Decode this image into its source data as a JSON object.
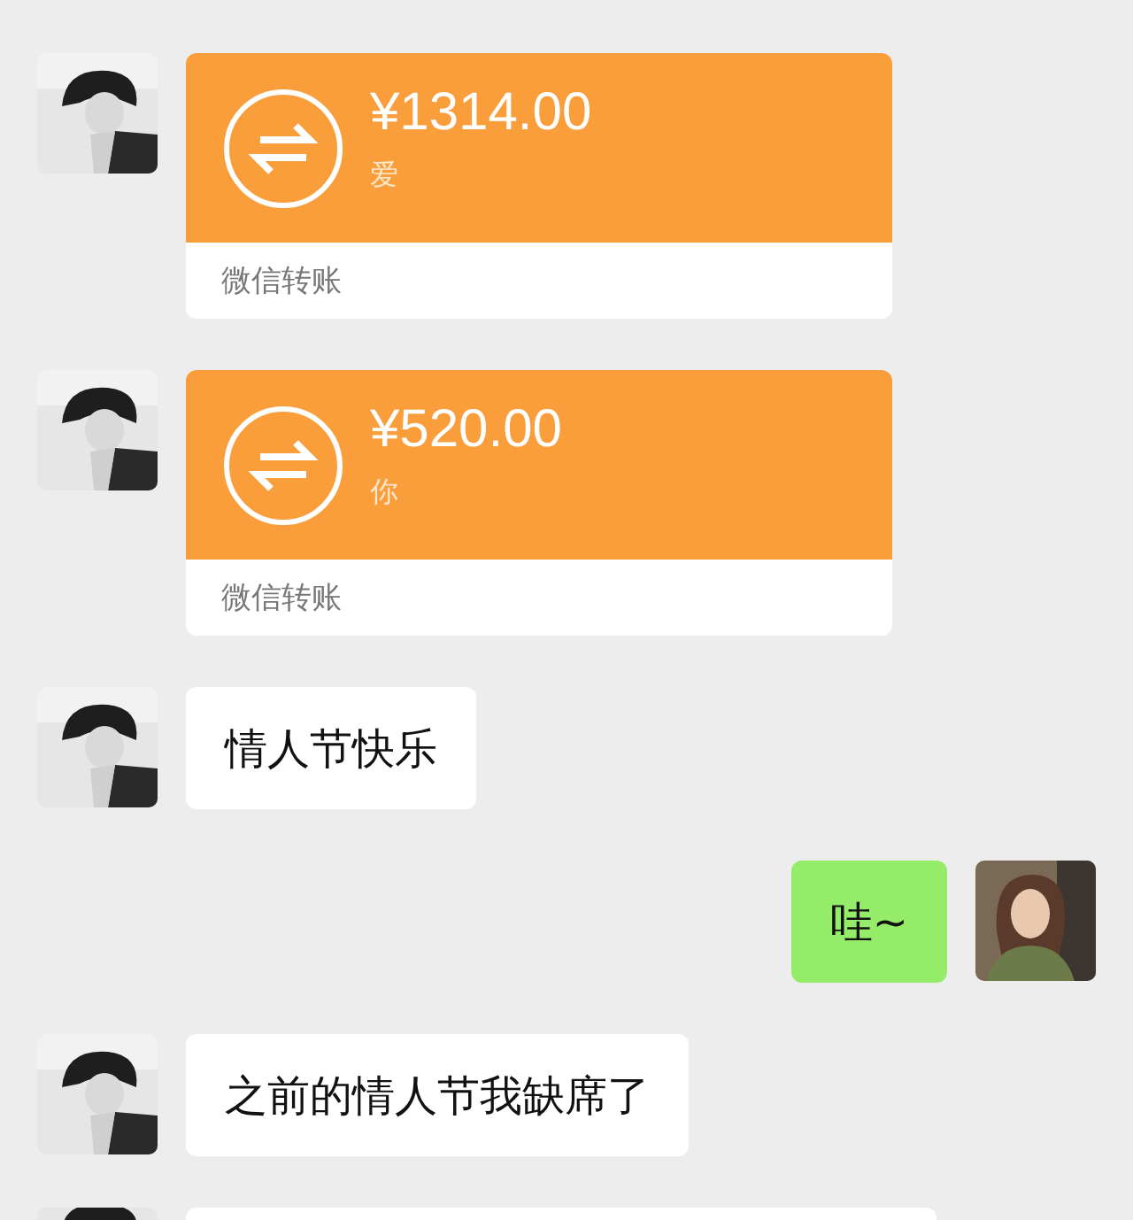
{
  "messages": [
    {
      "kind": "transfer",
      "outgoing": false,
      "amount": "¥1314.00",
      "note": "爱",
      "footer": "微信转账"
    },
    {
      "kind": "transfer",
      "outgoing": false,
      "amount": "¥520.00",
      "note": "你",
      "footer": "微信转账"
    },
    {
      "kind": "text",
      "outgoing": false,
      "text": "情人节快乐"
    },
    {
      "kind": "text",
      "outgoing": true,
      "text": "哇~"
    },
    {
      "kind": "text",
      "outgoing": false,
      "text": "之前的情人节我缺席了"
    },
    {
      "kind": "cut",
      "outgoing": false
    }
  ]
}
